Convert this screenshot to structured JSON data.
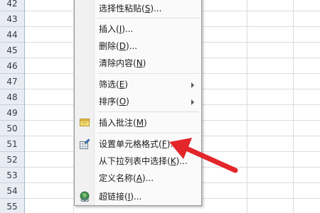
{
  "sheet": {
    "row_numbers": [
      "42",
      "43",
      "44",
      "45",
      "46",
      "47",
      "48",
      "49",
      "50",
      "51",
      "52",
      "53",
      "54",
      "55",
      "56"
    ]
  },
  "menu": {
    "items": [
      {
        "text": "选择性粘贴(",
        "key": "S",
        "suffix": ")..."
      },
      {
        "text": "插入(",
        "key": "I",
        "suffix": ")..."
      },
      {
        "text": "删除(",
        "key": "D",
        "suffix": ")..."
      },
      {
        "text": "清除内容(",
        "key": "N",
        "suffix": ")"
      },
      {
        "text": "筛选(",
        "key": "E",
        "suffix": ")"
      },
      {
        "text": "排序(",
        "key": "O",
        "suffix": ")"
      },
      {
        "text": "插入批注(",
        "key": "M",
        "suffix": ")"
      },
      {
        "text": "设置单元格格式(",
        "key": "F",
        "suffix": ")..."
      },
      {
        "text": "从下拉列表中选择(",
        "key": "K",
        "suffix": ")..."
      },
      {
        "text": "定义名称(",
        "key": "A",
        "suffix": ")..."
      },
      {
        "text": "超链接(",
        "key": "I",
        "suffix": ")..."
      }
    ],
    "icons": {
      "comment": "comment-note-icon",
      "format_cells": "format-cells-icon",
      "hyperlink": "hyperlink-globe-icon",
      "submenu": "submenu-arrow-icon"
    }
  },
  "colors": {
    "annotation_arrow": "#e3262a",
    "row_header_bg": "#e9edf3",
    "menu_bg": "#fafafa"
  }
}
